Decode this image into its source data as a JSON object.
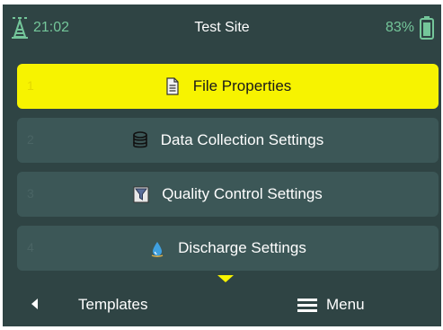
{
  "status_bar": {
    "time": "21:02",
    "title": "Test Site",
    "battery_percent": "83%",
    "signal_icon": "signal-tower-icon",
    "battery_icon": "battery-icon",
    "accent_color": "#74c69a"
  },
  "menu": {
    "items": [
      {
        "index": "1",
        "label": "File Properties",
        "icon": "document-icon",
        "selected": true
      },
      {
        "index": "2",
        "label": "Data Collection Settings",
        "icon": "database-icon",
        "selected": false
      },
      {
        "index": "3",
        "label": "Quality Control Settings",
        "icon": "filter-icon",
        "selected": false
      },
      {
        "index": "4",
        "label": "Discharge Settings",
        "icon": "water-drop-icon",
        "selected": false
      }
    ],
    "selected_color": "#f7f300",
    "item_color": "#3c5757"
  },
  "bottom_bar": {
    "left_label": "Templates",
    "left_icon": "chevron-left-icon",
    "right_label": "Menu",
    "right_icon": "hamburger-menu-icon"
  }
}
